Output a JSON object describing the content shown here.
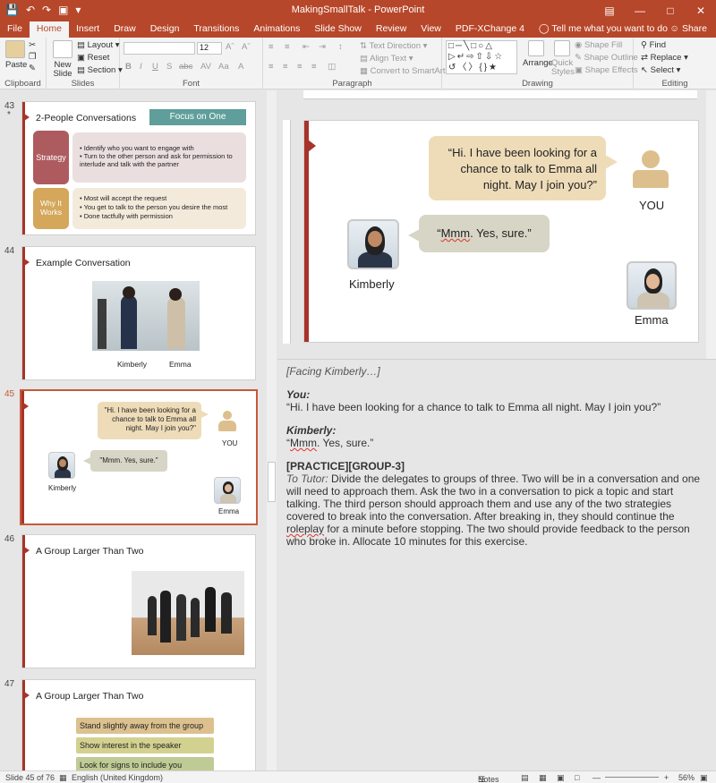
{
  "titlebar": {
    "title": "MakingSmallTalk  -  PowerPoint"
  },
  "tabs": [
    "File",
    "Home",
    "Insert",
    "Draw",
    "Design",
    "Transitions",
    "Animations",
    "Slide Show",
    "Review",
    "View",
    "PDF-XChange 4"
  ],
  "tell": "Tell me what you want to do",
  "share": "Share",
  "ribbon": {
    "clipboard": {
      "label": "Clipboard",
      "paste": "Paste"
    },
    "slides": {
      "label": "Slides",
      "new_slide": "New Slide",
      "layout": "Layout",
      "reset": "Reset",
      "section": "Section"
    },
    "font": {
      "label": "Font",
      "size": "12"
    },
    "paragraph": {
      "label": "Paragraph",
      "text_direction": "Text Direction",
      "align_text": "Align Text",
      "convert_smartart": "Convert to SmartArt"
    },
    "drawing": {
      "label": "Drawing",
      "arrange": "Arrange",
      "quick_styles": "Quick Styles",
      "shape_fill": "Shape Fill",
      "shape_outline": "Shape Outline",
      "shape_effects": "Shape Effects"
    },
    "editing": {
      "label": "Editing",
      "find": "Find",
      "replace": "Replace",
      "select": "Select"
    }
  },
  "thumbs": [
    {
      "num": "43",
      "star": "*",
      "title": "2-People Conversations",
      "banner": "Focus on One",
      "rows": [
        {
          "label": "Strategy",
          "bullets": [
            "Identify who you want to engage with",
            "Turn to the other person and ask for permission to interlude and talk with the partner"
          ]
        },
        {
          "label": "Why It Works",
          "bullets": [
            "Most will accept the request",
            "You get to talk to the person you desire the most",
            "Done tactfully with permission"
          ]
        }
      ]
    },
    {
      "num": "44",
      "title": "Example Conversation",
      "names": [
        "Kimberly",
        "Emma"
      ]
    },
    {
      "num": "45",
      "quote1": "\"Hi. I have been looking for a chance to talk to Emma all night. May I join you?\"",
      "you": "YOU",
      "quote2": "\"Mmm. Yes, sure.\"",
      "kimberly": "Kimberly",
      "emma": "Emma"
    },
    {
      "num": "46",
      "title": "A Group Larger Than Two"
    },
    {
      "num": "47",
      "title": "A Group Larger Than Two",
      "items": [
        "Stand slightly away from the group",
        "Show interest in the speaker",
        "Look for signs to include you"
      ]
    }
  ],
  "slide": {
    "quote1": "“Hi. I have been looking for a chance to talk to Emma all night. May I join you?”",
    "you": "YOU",
    "quote2_pre": "“",
    "quote2_word": "Mmm",
    "quote2_post": ". Yes, sure.”",
    "kimberly": "Kimberly",
    "emma": "Emma"
  },
  "notes": {
    "line1": "[Facing Kimberly…]",
    "you_label": "You:",
    "you_text": "“Hi. I have been looking for a chance to talk to Emma all night. May I join you?”",
    "kim_label": "Kimberly:",
    "kim_text_pre": "“",
    "kim_word": "Mmm",
    "kim_text_post": ". Yes, sure.”",
    "practice": "[PRACTICE][GROUP-3]",
    "tutor_label": "To Tutor:",
    "tutor_pre": " Divide the delegates to groups of three. Two will be in a conversation and one will need to approach them. Ask the two in a conversation to pick a topic and start talking. The third person should approach them and use any of the two strategies covered to break into the conversation. After breaking in, they should continue the ",
    "tutor_word": "roleplay",
    "tutor_post": " for a minute before stopping. The two should provide feedback to the person who broke in. Allocate 10 minutes for this exercise."
  },
  "status": {
    "slide": "Slide 45 of 76",
    "lang": "English (United Kingdom)",
    "notes": "Notes",
    "zoom": "56%"
  }
}
